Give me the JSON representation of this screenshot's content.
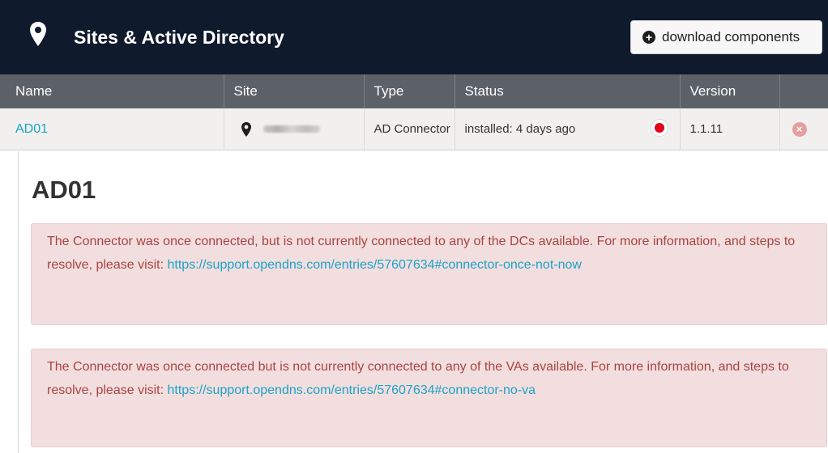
{
  "header": {
    "title": "Sites & Active Directory",
    "download_label": "download components"
  },
  "table": {
    "columns": [
      "Name",
      "Site",
      "Type",
      "Status",
      "Version",
      ""
    ],
    "rows": [
      {
        "name": "AD01",
        "type": "AD Connector",
        "status": "installed: 4 days ago",
        "status_color": "#e3001b",
        "version": "1.1.11"
      }
    ]
  },
  "detail": {
    "title": "AD01",
    "alerts": [
      {
        "text": "The Connector was once connected, but is not currently connected to any of the DCs available. For more information, and steps to resolve, please visit: ",
        "link": "https://support.opendns.com/entries/57607634#connector-once-not-now"
      },
      {
        "text": "The Connector was once connected but is not currently connected to any of the VAs available. For more information, and steps to resolve, please visit: ",
        "link": "https://support.opendns.com/entries/57607634#connector-no-va"
      }
    ]
  },
  "icons": {
    "header": "map-pin-icon",
    "download": "plus-circle-icon",
    "site": "map-pin-icon",
    "remove": "close-circle-icon"
  }
}
